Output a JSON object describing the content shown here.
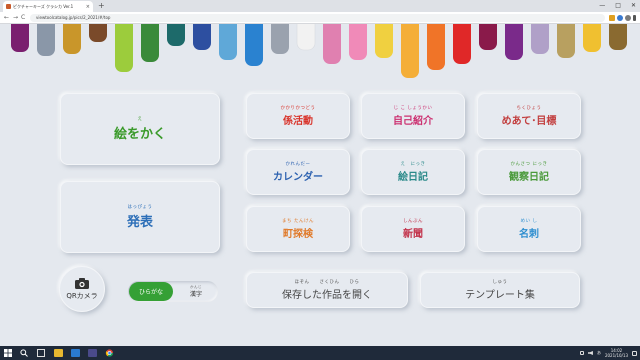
{
  "browser": {
    "tab_title": "ピクチャーキーズ クラシカ Ver.1",
    "tab_close": "×",
    "new_tab": "+",
    "window_controls": [
      "—",
      "□",
      "✕"
    ],
    "nav": {
      "back": "←",
      "forward": "→",
      "reload": "C"
    },
    "url": "viewtoolcatalog.jp/pics/2_2021/#/top",
    "toolbar_icons": [
      "star-icon",
      "extension-icon",
      "profile-icon",
      "menu-icon"
    ]
  },
  "app": {
    "draw": {
      "ruby": "え",
      "label": "絵をかく",
      "color": "#3a9a2a"
    },
    "present": {
      "ruby": "はっぴょう",
      "label": "発表",
      "color": "#2d6fb8"
    },
    "grid": [
      {
        "id": "kakari",
        "ruby": "かかりかつどう",
        "label": "係活動",
        "color": "#d9342b"
      },
      {
        "id": "jiko",
        "ruby": "じ こ しょうかい",
        "label": "自己紹介",
        "color": "#cc3070"
      },
      {
        "id": "meate",
        "ruby": "ちくひょう",
        "label": "めあて･目標",
        "color": "#c23d3d"
      },
      {
        "id": "calendar",
        "ruby": "かれんだー",
        "label": "カレンダー",
        "color": "#2d62b0"
      },
      {
        "id": "enikki",
        "ruby": "え　にっき",
        "label": "絵日記",
        "color": "#2b8a8a"
      },
      {
        "id": "kansatsu",
        "ruby": "かんさつ にっき",
        "label": "観察日記",
        "color": "#4a9a3a"
      },
      {
        "id": "machi",
        "ruby": "まち たんけん",
        "label": "町探検",
        "color": "#e07a2a"
      },
      {
        "id": "shinbun",
        "ruby": "しんぶん",
        "label": "新聞",
        "color": "#c2324a"
      },
      {
        "id": "meishi",
        "ruby": "めい し",
        "label": "名刺",
        "color": "#2f8fd0"
      }
    ],
    "saved": {
      "ruby": "ほぞん　　さくひん　　ひら",
      "label": "保存した作品を開く",
      "color": "#444444"
    },
    "template": {
      "ruby": "しゅう",
      "label": "テンプレート集",
      "color": "#444444"
    },
    "qr": {
      "label": "QRカメラ",
      "icon": "camera-icon"
    },
    "script_toggle": {
      "on_label": "ひらがな",
      "off_ruby": "かんじ",
      "off_label": "漢字",
      "on_color": "#35a035"
    }
  },
  "drip_colors": [
    "#7a1f6f",
    "#8a97a8",
    "#c9962a",
    "#7a4a2a",
    "#9ccc3c",
    "#3a8a3a",
    "#1d6a6a",
    "#2d4fa0",
    "#5fa8d8",
    "#2a82d0",
    "#9aa2ae",
    "#f2f2f2",
    "#e080b0",
    "#f08ab8",
    "#f0d040",
    "#f4ae38",
    "#f07428",
    "#e02828",
    "#8a1a4a",
    "#7a2a8a",
    "#b0a0c8",
    "#b8a060",
    "#f0c030",
    "#8a6a30"
  ],
  "taskbar": {
    "start_icon": "windows-start-icon",
    "search_icon": "search-icon",
    "apps": [
      "task-view-icon",
      "file-explorer-icon",
      "mail-icon",
      "store-icon",
      "chrome-icon"
    ],
    "time": "14:02",
    "date": "2021/10/13",
    "ime": "あ"
  }
}
